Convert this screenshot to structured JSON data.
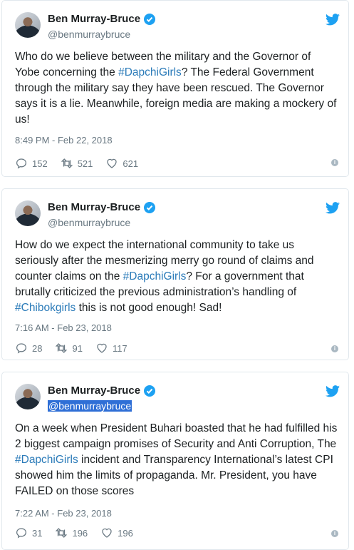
{
  "colors": {
    "link": "#2b7bb9",
    "verified": "#1da1f2",
    "meta": "#697882"
  },
  "tweets": [
    {
      "name": "Ben Murray-Bruce",
      "handle": "@benmurraybruce",
      "segments": [
        {
          "t": "Who do we believe between the military and the Governor of Yobe concerning the "
        },
        {
          "t": "#DapchiGirls",
          "tag": true
        },
        {
          "t": "? The Federal Government through the military say they have been rescued. The Governor says it is a lie. Meanwhile, foreign media are making a mockery of us!"
        }
      ],
      "time": "8:49 PM - Feb 22, 2018",
      "replies": "152",
      "retweets": "521",
      "likes": "621"
    },
    {
      "name": "Ben Murray-Bruce",
      "handle": "@benmurraybruce",
      "segments": [
        {
          "t": "How do we expect the international community to take us seriously after the mesmerizing merry go round of claims and counter claims on the "
        },
        {
          "t": "#DapchiGirls",
          "tag": true
        },
        {
          "t": "? For a government that brutally criticized the previous administration’s handling of "
        },
        {
          "t": "#Chibokgirls",
          "tag": true
        },
        {
          "t": " this is not good enough! Sad!"
        }
      ],
      "time": "7:16 AM - Feb 23, 2018",
      "replies": "28",
      "retweets": "91",
      "likes": "117"
    },
    {
      "name": "Ben Murray-Bruce",
      "handle": "@benmurraybruce",
      "segments": [
        {
          "t": "On a week when President Buhari boasted that he had fulfilled his 2 biggest campaign promises of Security and Anti Corruption, The "
        },
        {
          "t": "#DapchiGirls",
          "tag": true
        },
        {
          "t": " incident and Transparency International’s latest CPI showed him the limits of propaganda. Mr. President, you have FAILED on those scores"
        }
      ],
      "time": "7:22 AM - Feb 23, 2018",
      "replies": "31",
      "retweets": "196",
      "likes": "196"
    }
  ]
}
